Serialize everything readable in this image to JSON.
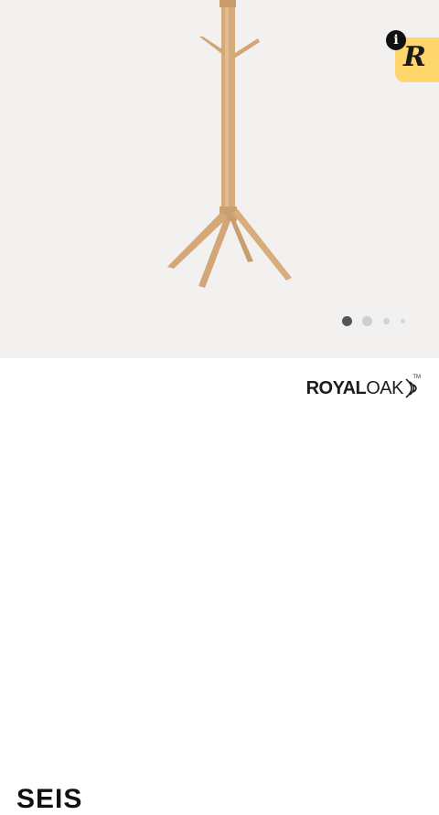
{
  "gallery": {
    "image_alt": "coat-stand-product-photo",
    "page_indicator": {
      "count": 4,
      "active_index": 0
    },
    "info_icon": "i",
    "promo_badge_letter": "R",
    "colors": {
      "background": "#f2f1f0",
      "wood": "#d4a878",
      "badge": "#ffd66b"
    }
  },
  "brand": {
    "name_bold": "ROYAL",
    "name_light": "OAK",
    "trademark": "TM"
  },
  "product": {
    "title": "SEIS"
  }
}
